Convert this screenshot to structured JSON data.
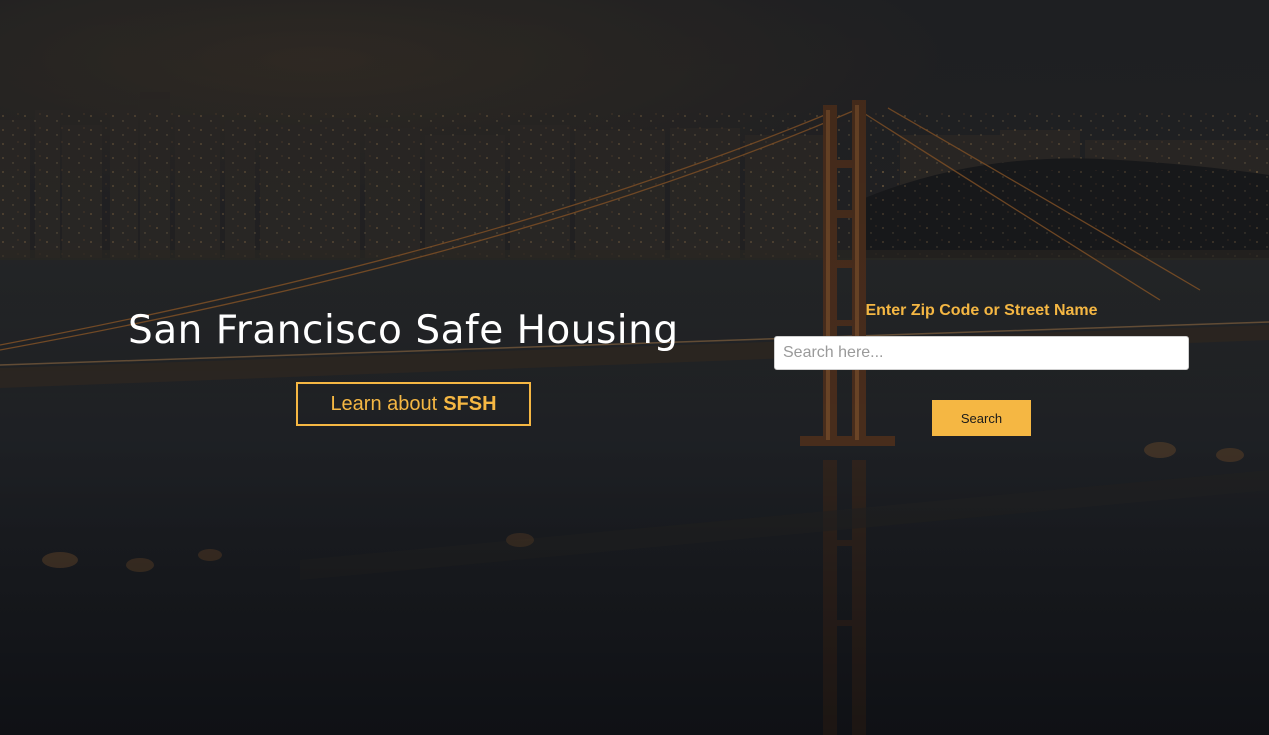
{
  "hero": {
    "title": "San Francisco Safe Housing",
    "learn_button": {
      "prefix": "Learn about",
      "emphasis": "SFSH"
    }
  },
  "search": {
    "label": "Enter Zip Code or Street Name",
    "placeholder": "Search here...",
    "value": "",
    "button_label": "Search"
  },
  "colors": {
    "accent": "#f5b743",
    "overlay": "#14161c",
    "title_text": "#ffffff"
  }
}
